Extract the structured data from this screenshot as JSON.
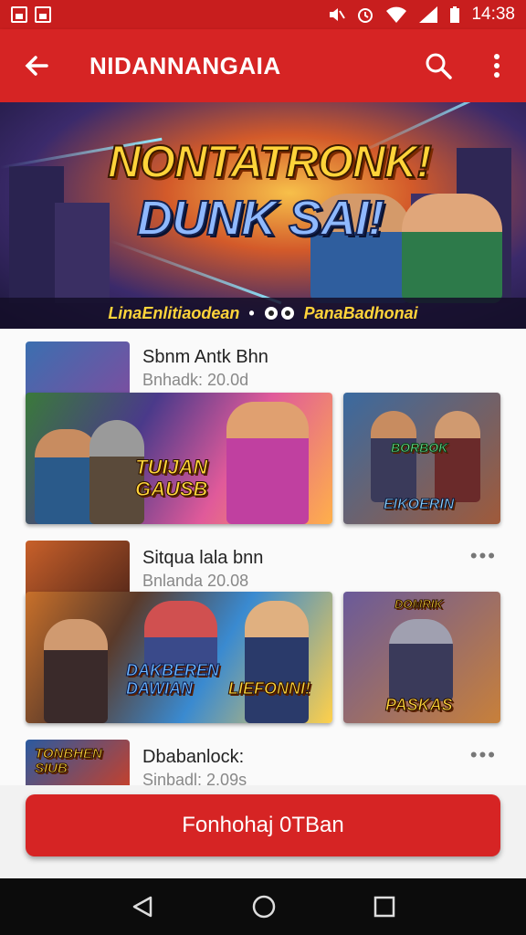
{
  "status_bar": {
    "time": "14:38",
    "icons": [
      "notification-box-icon",
      "notification-image-icon",
      "mute-icon",
      "alarm-icon",
      "wifi-icon",
      "signal-icon",
      "battery-icon"
    ]
  },
  "app_bar": {
    "title": "NIDANNANGAIA",
    "icons": [
      "back-arrow-icon",
      "search-icon",
      "overflow-menu-icon"
    ]
  },
  "hero": {
    "title_line1": "NONTATRONK!",
    "title_line2": "DUNK SAI!",
    "caption_left": "LinaEnlitiaodean",
    "caption_sep": "•",
    "caption_right": "PanaBadhonai"
  },
  "items": [
    {
      "name": "Sbnm Antk Bhn",
      "subtitle": "Bnhadk: 20.0d",
      "art_label_main": "TUIJAN GAUSB",
      "art_label_side": "ElKOERIN",
      "side_badge": "BORBOK",
      "has_menu": false
    },
    {
      "name": "Sitqua lala bnn",
      "subtitle": "Bnlanda 20.08",
      "art_label_main_left": "DAKBEREN DAWIAN",
      "art_label_main_right": "LIEFONNI!",
      "art_label_side": "PASKAS",
      "side_badge": "DOMRIK",
      "has_menu": true
    },
    {
      "name": "Dbabanlock:",
      "subtitle": "Sinbadl: 2.09s",
      "art_label_main": "TONBHEN SIUB",
      "has_menu": true
    }
  ],
  "cta": {
    "label": "Fonhohaj 0TBan"
  },
  "colors": {
    "primary": "#d62424",
    "status": "#c81e1e",
    "background": "#fafafa"
  }
}
